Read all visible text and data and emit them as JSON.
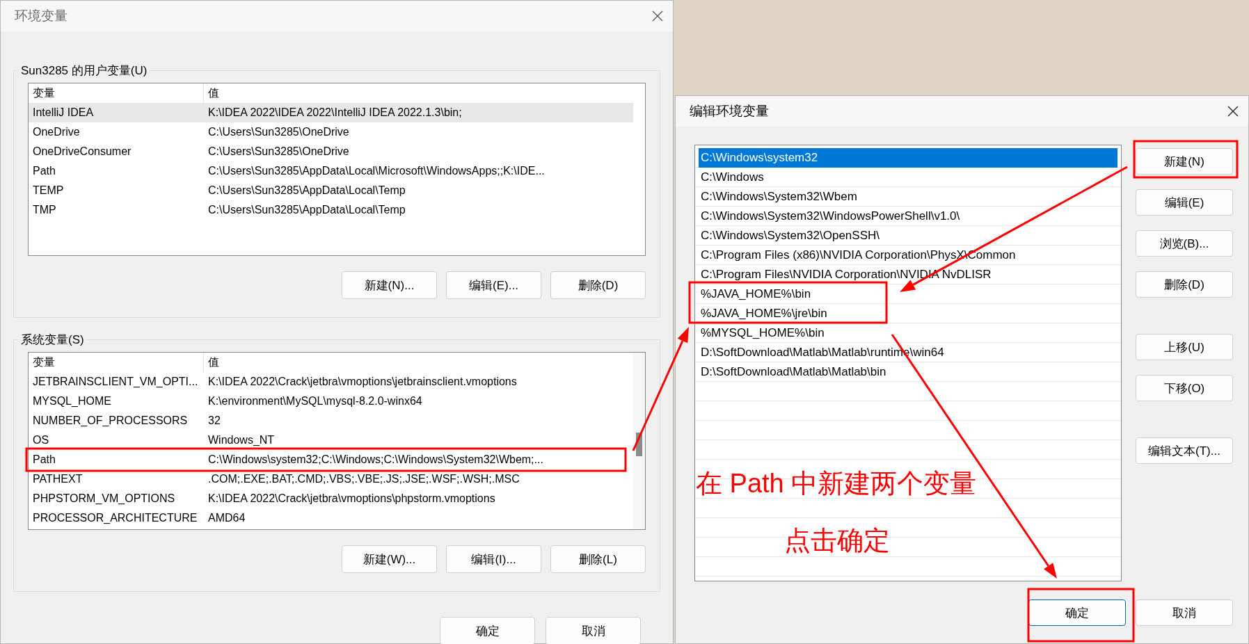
{
  "env_dialog": {
    "title": "环境变量",
    "user_group": {
      "label": "Sun3285 的用户变量(U)",
      "columns": [
        "变量",
        "值"
      ],
      "rows": [
        {
          "name": "IntelliJ IDEA",
          "value": "K:\\IDEA 2022\\IDEA 2022\\IntelliJ IDEA 2022.1.3\\bin;",
          "selected": true
        },
        {
          "name": "OneDrive",
          "value": "C:\\Users\\Sun3285\\OneDrive",
          "selected": false
        },
        {
          "name": "OneDriveConsumer",
          "value": "C:\\Users\\Sun3285\\OneDrive",
          "selected": false
        },
        {
          "name": "Path",
          "value": "C:\\Users\\Sun3285\\AppData\\Local\\Microsoft\\WindowsApps;;K:\\IDE...",
          "selected": false
        },
        {
          "name": "TEMP",
          "value": "C:\\Users\\Sun3285\\AppData\\Local\\Temp",
          "selected": false
        },
        {
          "name": "TMP",
          "value": "C:\\Users\\Sun3285\\AppData\\Local\\Temp",
          "selected": false
        }
      ],
      "buttons": [
        "新建(N)...",
        "编辑(E)...",
        "删除(D)"
      ]
    },
    "system_group": {
      "label": "系统变量(S)",
      "columns": [
        "变量",
        "值"
      ],
      "rows": [
        {
          "name": "JETBRAINSCLIENT_VM_OPTI...",
          "value": "K:\\IDEA 2022\\Crack\\jetbra\\vmoptions\\jetbrainsclient.vmoptions",
          "selected": false
        },
        {
          "name": "MYSQL_HOME",
          "value": "K:\\environment\\MySQL\\mysql-8.2.0-winx64",
          "selected": false
        },
        {
          "name": "NUMBER_OF_PROCESSORS",
          "value": "32",
          "selected": false
        },
        {
          "name": "OS",
          "value": "Windows_NT",
          "selected": false
        },
        {
          "name": "Path",
          "value": "C:\\Windows\\system32;C:\\Windows;C:\\Windows\\System32\\Wbem;...",
          "selected": false
        },
        {
          "name": "PATHEXT",
          "value": ".COM;.EXE;.BAT;.CMD;.VBS;.VBE;.JS;.JSE;.WSF;.WSH;.MSC",
          "selected": false
        },
        {
          "name": "PHPSTORM_VM_OPTIONS",
          "value": "K:\\IDEA 2022\\Crack\\jetbra\\vmoptions\\phpstorm.vmoptions",
          "selected": false
        },
        {
          "name": "PROCESSOR_ARCHITECTURE",
          "value": "AMD64",
          "selected": false
        }
      ],
      "buttons": [
        "新建(W)...",
        "编辑(I)...",
        "删除(L)"
      ]
    },
    "buttons": [
      {
        "label": "确定",
        "default": false
      },
      {
        "label": "取消",
        "default": false
      }
    ]
  },
  "edit_dialog": {
    "title": "编辑环境变量",
    "entries": [
      {
        "text": "C:\\Windows\\system32",
        "selected": true
      },
      {
        "text": "C:\\Windows",
        "selected": false
      },
      {
        "text": "C:\\Windows\\System32\\Wbem",
        "selected": false
      },
      {
        "text": "C:\\Windows\\System32\\WindowsPowerShell\\v1.0\\",
        "selected": false
      },
      {
        "text": "C:\\Windows\\System32\\OpenSSH\\",
        "selected": false
      },
      {
        "text": "C:\\Program Files (x86)\\NVIDIA Corporation\\PhysX\\Common",
        "selected": false
      },
      {
        "text": "C:\\Program Files\\NVIDIA Corporation\\NVIDIA NvDLISR",
        "selected": false
      },
      {
        "text": "%JAVA_HOME%\\bin",
        "selected": false
      },
      {
        "text": "%JAVA_HOME%\\jre\\bin",
        "selected": false
      },
      {
        "text": "%MYSQL_HOME%\\bin",
        "selected": false
      },
      {
        "text": "D:\\SoftDownload\\Matlab\\Matlab\\runtime\\win64",
        "selected": false
      },
      {
        "text": "D:\\SoftDownload\\Matlab\\Matlab\\bin",
        "selected": false
      }
    ],
    "side_buttons": [
      [
        "新建(N)",
        "编辑(E)",
        "浏览(B)...",
        "删除(D)"
      ],
      [
        "上移(U)",
        "下移(O)"
      ],
      [
        "编辑文本(T)..."
      ]
    ],
    "buttons": [
      {
        "label": "确定",
        "default": true
      },
      {
        "label": "取消",
        "default": false
      }
    ]
  },
  "annotations": [
    "在 Path 中新建两个变量",
    "点击确定"
  ]
}
